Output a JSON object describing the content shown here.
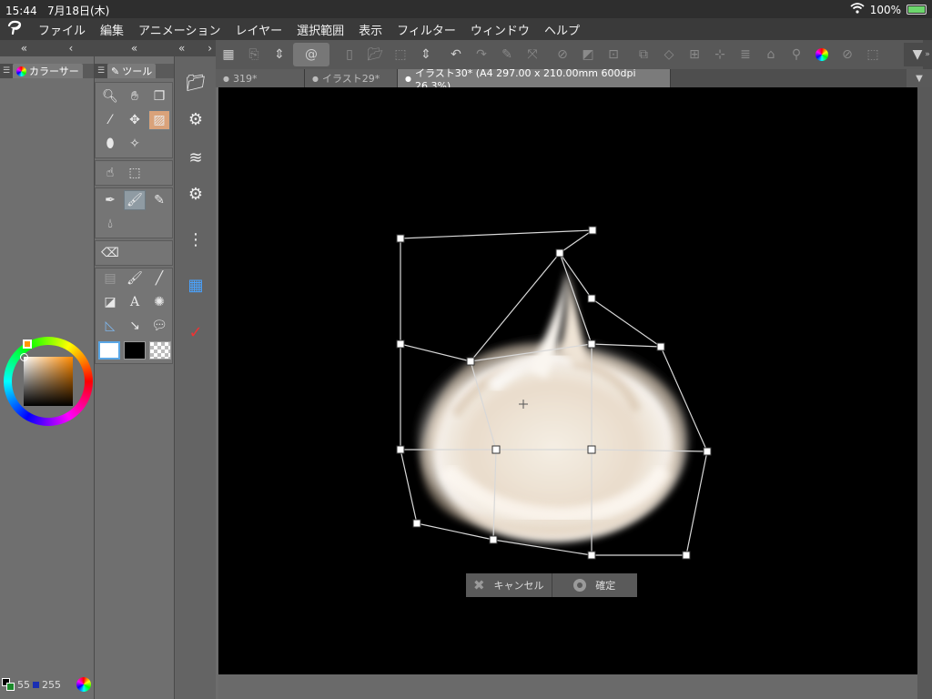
{
  "status": {
    "time": "15:44",
    "date": "7月18日(木)",
    "battery": "100%"
  },
  "menu": {
    "items": [
      "ファイル",
      "編集",
      "アニメーション",
      "レイヤー",
      "選択範囲",
      "表示",
      "フィルター",
      "ウィンドウ",
      "ヘルプ"
    ]
  },
  "panels": {
    "color_tab": "カラーサー",
    "tool_tab": "ツール"
  },
  "doc_tabs": [
    {
      "label": "319*"
    },
    {
      "label": "イラスト29*"
    },
    {
      "label": "イラスト30* (A4 297.00 x 210.00mm 600dpi 26.3%)"
    }
  ],
  "transform": {
    "cancel_label": "キャンセル",
    "ok_label": "確定"
  },
  "color_values": {
    "left": "55",
    "right": "255"
  },
  "colors": {
    "accent": "#8f9ba3",
    "canvas": "#000000",
    "panel": "#757575"
  }
}
